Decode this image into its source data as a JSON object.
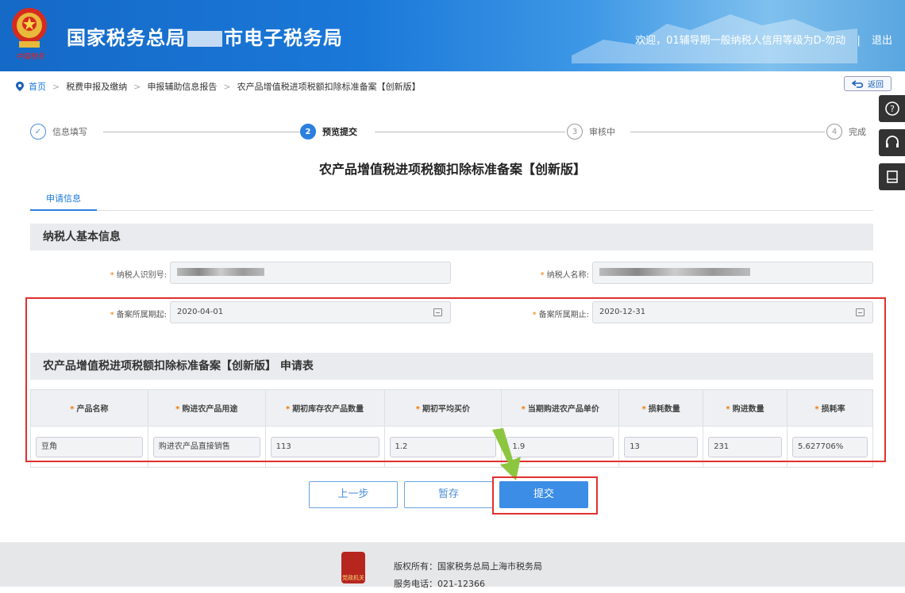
{
  "header": {
    "title_left": "国家税务总局",
    "title_right": "市电子税务局",
    "logo_script": "中国税务",
    "welcome": "欢迎，01辅导期一般纳税人信用等级为D-勿动",
    "logout": "退出"
  },
  "breadcrumb": {
    "items": [
      "首页",
      "税费申报及缴纳",
      "申报辅助信息报告",
      "农产品增值税进项税额扣除标准备案【创新版】"
    ]
  },
  "back_label": "返回",
  "steps": [
    {
      "num": "1",
      "label": "信息填写",
      "state": "done"
    },
    {
      "num": "2",
      "label": "预览提交",
      "state": "active"
    },
    {
      "num": "3",
      "label": "审核中",
      "state": "pending"
    },
    {
      "num": "4",
      "label": "完成",
      "state": "pending"
    }
  ],
  "form_title": "农产品增值税进项税额扣除标准备案【创新版】",
  "tab_label": "申请信息",
  "basic_info": {
    "heading": "纳税人基本信息",
    "taxpayer_id_label": "纳税人识别号:",
    "taxpayer_name_label": "纳税人名称:",
    "period_start_label": "备案所属期起:",
    "period_start_value": "2020-04-01",
    "period_end_label": "备案所属期止:",
    "period_end_value": "2020-12-31"
  },
  "application": {
    "heading": "农产品增值税进项税额扣除标准备案【创新版】 申请表",
    "columns": [
      "产品名称",
      "购进农产品用途",
      "期初库存农产品数量",
      "期初平均买价",
      "当期购进农产品单价",
      "损耗数量",
      "购进数量",
      "损耗率"
    ],
    "rows": [
      [
        "豆角",
        "购进农产品直接销售",
        "113",
        "1.2",
        "1.9",
        "13",
        "231",
        "5.627706%"
      ]
    ]
  },
  "buttons": {
    "prev": "上一步",
    "save": "暂存",
    "submit": "提交"
  },
  "footer": {
    "copyright": "版权所有：国家税务总局上海市税务局",
    "phone": "服务电话：021-12366",
    "logo_text": "党政机关"
  },
  "colors": {
    "header_blue": "#1a78d8",
    "accent": "#3b8de6",
    "highlight_red": "#e0302e",
    "required_orange": "#f07800"
  }
}
